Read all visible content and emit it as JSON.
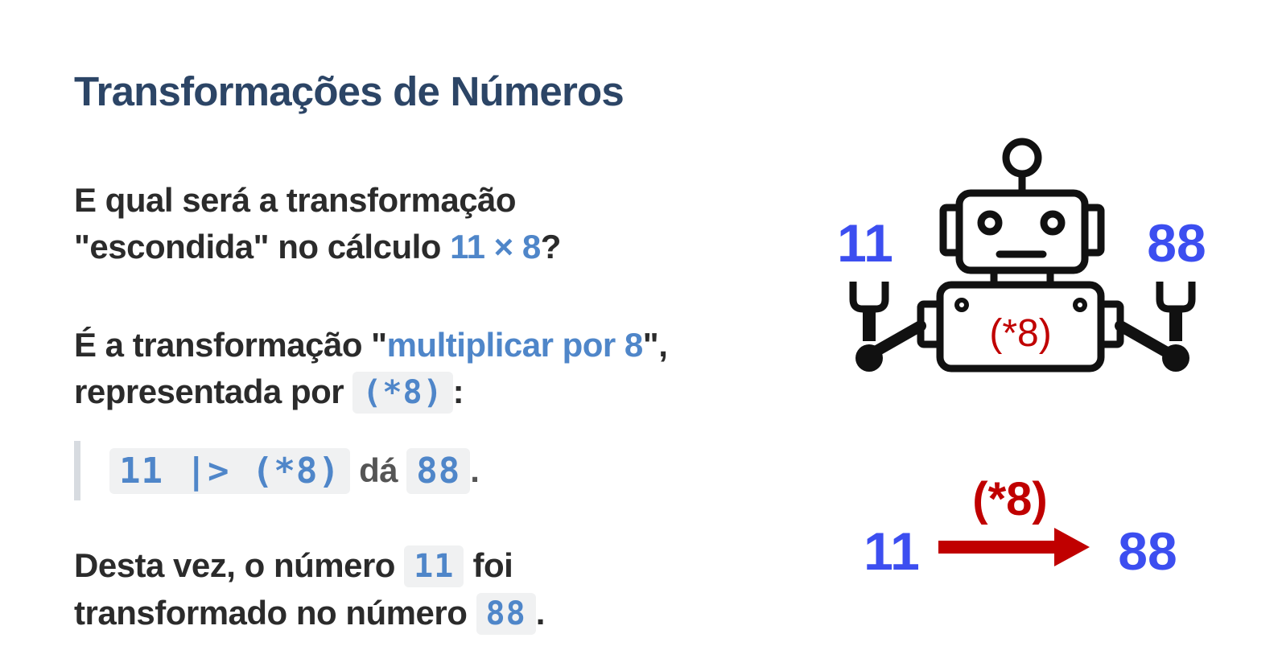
{
  "title": "Transformações de Números",
  "p1": {
    "line1": "E qual será a transformação",
    "line2_pre": "\"escondida\" no cálculo ",
    "line2_hl": "11 × 8",
    "line2_post": "?"
  },
  "p2": {
    "line1_pre": "É a transformação \"",
    "line1_hl": "multiplicar por 8",
    "line1_post": "\",",
    "line2_pre": "representada por ",
    "line2_code": "(*8)",
    "line2_post": ":"
  },
  "quote": {
    "code1": "11 |> (*8)",
    "mid": " dá ",
    "code2": "88",
    "end": "."
  },
  "p4": {
    "line1_pre": "Desta vez, o número ",
    "line1_code": "11",
    "line1_post": " foi",
    "line2_pre": "transformado no número ",
    "line2_code": "88",
    "line2_post": "."
  },
  "robot": {
    "input": "11",
    "output": "88",
    "label": "(*8)"
  },
  "arrow_diagram": {
    "input": "11",
    "label": "(*8)",
    "output": "88"
  },
  "colors": {
    "title": "#2c4566",
    "highlight": "#4f86c9",
    "number_blue": "#3c4ef0",
    "operation_red": "#c00000"
  }
}
